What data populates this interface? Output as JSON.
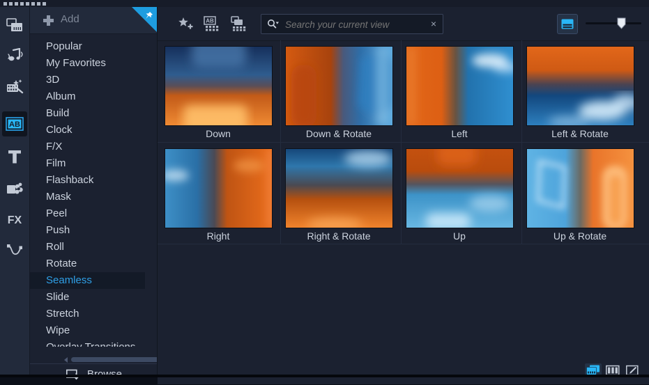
{
  "window": {
    "grip_dots": 8,
    "pin_title": "Pin panel"
  },
  "rail": {
    "items": [
      {
        "id": "media",
        "icon": "media-library-icon",
        "label": "Media",
        "selected": false
      },
      {
        "id": "audio",
        "icon": "music-note-icon",
        "label": "Audio",
        "selected": false
      },
      {
        "id": "effects",
        "icon": "magic-wand-filmstrip-icon",
        "label": "Effects",
        "selected": false
      },
      {
        "id": "transitions",
        "icon": "ab-transition-icon",
        "label": "Transitions",
        "selected": true
      },
      {
        "id": "titles",
        "icon": "text-t-icon",
        "label": "Titles",
        "selected": false
      },
      {
        "id": "graphics",
        "icon": "graphics-flower-icon",
        "label": "Graphics",
        "selected": false
      },
      {
        "id": "fx",
        "icon": "fx-text-icon",
        "label": "FX",
        "selected": false
      },
      {
        "id": "path",
        "icon": "motion-path-icon",
        "label": "Path",
        "selected": false
      }
    ]
  },
  "library": {
    "add_label": "Add",
    "add_icon": "plus-icon",
    "pin_icon": "pushpin-icon",
    "browse_label": "Browse",
    "browse_icon": "browse-folder-icon",
    "categories": [
      {
        "label": "Popular",
        "selected": false
      },
      {
        "label": "My Favorites",
        "selected": false
      },
      {
        "label": "3D",
        "selected": false
      },
      {
        "label": "Album",
        "selected": false
      },
      {
        "label": "Build",
        "selected": false
      },
      {
        "label": "Clock",
        "selected": false
      },
      {
        "label": "F/X",
        "selected": false
      },
      {
        "label": "Film",
        "selected": false
      },
      {
        "label": "Flashback",
        "selected": false
      },
      {
        "label": "Mask",
        "selected": false
      },
      {
        "label": "Peel",
        "selected": false
      },
      {
        "label": "Push",
        "selected": false
      },
      {
        "label": "Roll",
        "selected": false
      },
      {
        "label": "Rotate",
        "selected": false
      },
      {
        "label": "Seamless",
        "selected": true
      },
      {
        "label": "Slide",
        "selected": false
      },
      {
        "label": "Stretch",
        "selected": false
      },
      {
        "label": "Wipe",
        "selected": false
      },
      {
        "label": "Overlay Transitions",
        "selected": false
      }
    ]
  },
  "toolbar": {
    "add_favorite_icon": "star-plus-icon",
    "show_transitions_icon": "ab-grid-icon",
    "show_media_icon": "filmstrip-grid-icon",
    "search": {
      "icon": "search-dropdown-icon",
      "placeholder": "Search your current view",
      "value": "",
      "clear_icon": "clear-x-icon",
      "clear_label": "×"
    },
    "view_toggle_icon": "large-thumbnail-view-icon",
    "zoom_slider": {
      "label": "Thumbnail size",
      "value_percent": 67
    }
  },
  "grid": {
    "items": [
      {
        "label": "Down",
        "thumb": "down-thumbnail"
      },
      {
        "label": "Down & Rotate",
        "thumb": "down-rotate-thumbnail"
      },
      {
        "label": "Left",
        "thumb": "left-thumbnail"
      },
      {
        "label": "Left & Rotate",
        "thumb": "left-rotate-thumbnail"
      },
      {
        "label": "Right",
        "thumb": "right-thumbnail"
      },
      {
        "label": "Right & Rotate",
        "thumb": "right-rotate-thumbnail"
      },
      {
        "label": "Up",
        "thumb": "up-thumbnail"
      },
      {
        "label": "Up & Rotate",
        "thumb": "up-rotate-thumbnail"
      }
    ]
  },
  "statusbar": {
    "buttons": [
      {
        "icon": "library-view-icon",
        "label": "Library view",
        "active": true
      },
      {
        "icon": "columns-view-icon",
        "label": "Storyboard view",
        "active": false
      },
      {
        "icon": "edit-pencil-icon",
        "label": "Edit",
        "active": false
      }
    ]
  },
  "colors": {
    "accent_blue": "#1e9de0",
    "selected_text": "#2f9fe6",
    "panel_bg": "#1b2130",
    "rail_bg": "#222a3b",
    "thumb_orange": "#e2671a",
    "thumb_blue": "#2a7fc4"
  }
}
